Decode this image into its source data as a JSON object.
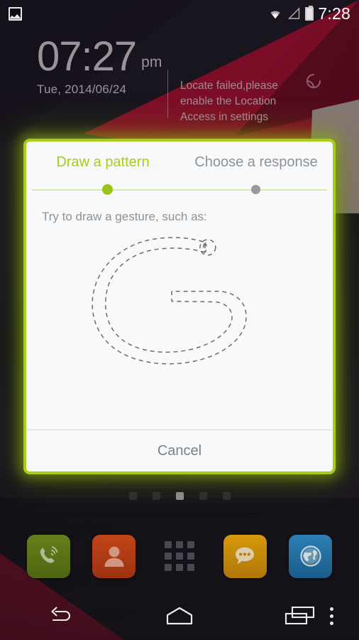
{
  "statusbar": {
    "notification_icon": "photo-icon",
    "wifi_icon": "wifi-icon",
    "signal_icon": "signal-triangle-icon",
    "battery_icon": "battery-icon",
    "time": "7:28"
  },
  "clock_widget": {
    "time": "07:27",
    "ampm": "pm",
    "date": "Tue, 2014/06/24",
    "weather_message": "Locate failed,please enable the Location Access in settings",
    "refresh_icon": "refresh-icon"
  },
  "dialog": {
    "tabs": [
      {
        "label": "Draw a pattern",
        "active": true
      },
      {
        "label": "Choose a response",
        "active": false
      }
    ],
    "steps": [
      {
        "state": "active",
        "color": "#9ac41a"
      },
      {
        "state": "inactive",
        "color": "#9a9a9a"
      }
    ],
    "instruction": "Try to draw a gesture, such as:",
    "gesture_hint_letter": "G",
    "cancel_label": "Cancel",
    "border_color": "#a6ce15",
    "background_color": "#f8f9fa"
  },
  "page_indicator": {
    "count": 5,
    "active_index": 2
  },
  "dock": {
    "items": [
      {
        "name": "phone",
        "icon": "phone-icon",
        "color": "#5c7216"
      },
      {
        "name": "contacts",
        "icon": "person-icon",
        "color": "#b53d16"
      },
      {
        "name": "app-drawer",
        "icon": "apps-grid-icon",
        "color": "transparent"
      },
      {
        "name": "messaging",
        "icon": "chat-bubble-icon",
        "color": "#c98a09"
      },
      {
        "name": "browser",
        "icon": "globe-icon",
        "color": "#1f6ea4"
      }
    ]
  },
  "navbar": {
    "back_icon": "back-arrow-icon",
    "home_icon": "home-icon",
    "recents_icon": "recents-icon",
    "overflow_icon": "overflow-menu-icon"
  }
}
